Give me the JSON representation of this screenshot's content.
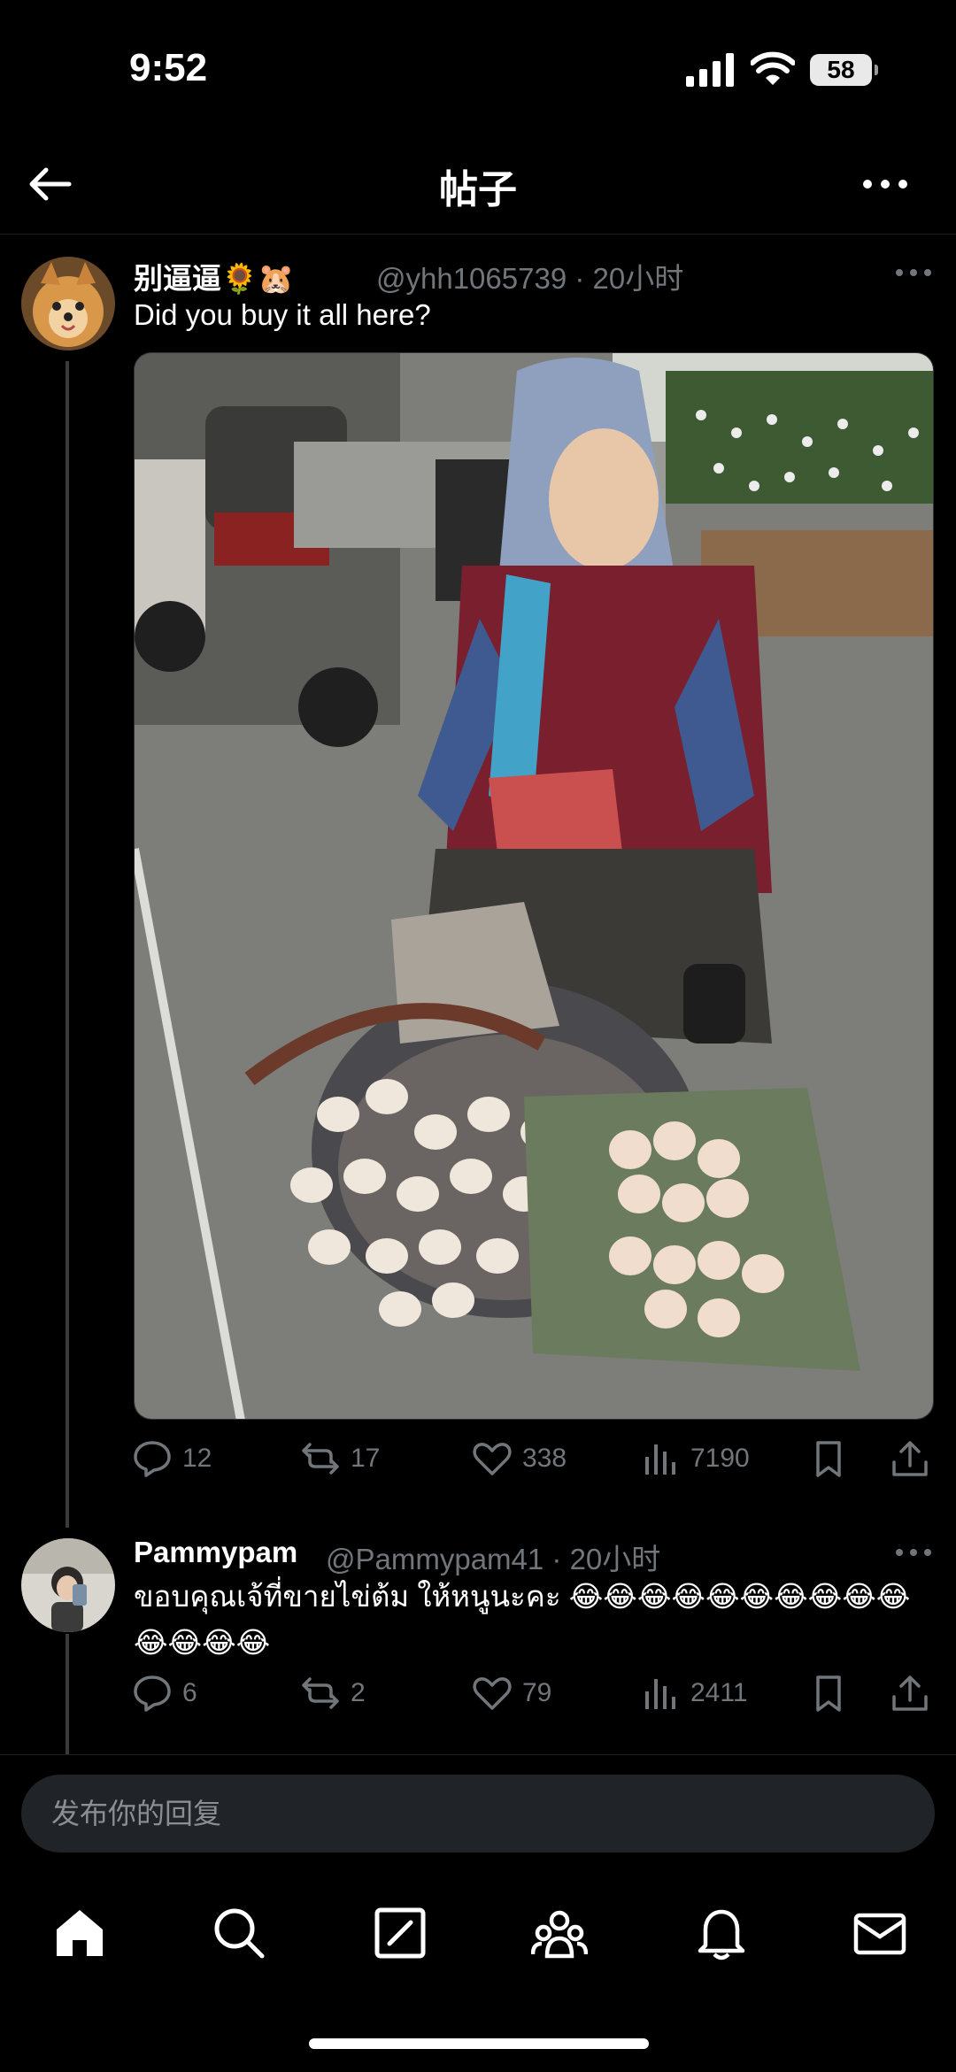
{
  "status_bar": {
    "time": "9:52",
    "battery": "58"
  },
  "header": {
    "title": "帖子"
  },
  "tweets": [
    {
      "name": "别逼逼🌻🐹",
      "handle_time": "@yhh1065739 · 20小时",
      "text": "Did you buy it all here?",
      "image_alt": "woman with basket of eggs",
      "stats": {
        "replies": "12",
        "reposts": "17",
        "likes": "338",
        "views": "7190"
      }
    },
    {
      "name": "Pammypam",
      "handle_time": "@Pammypam41 · 20小时",
      "text": "ขอบคุณเจ้ที่ขายไข่ต้ม ให้หนูนะคะ 😂😂😂😂😂😂😂😂😂😂😂😂😂😂",
      "stats": {
        "replies": "6",
        "reposts": "2",
        "likes": "79",
        "views": "2411"
      }
    }
  ],
  "reply": {
    "placeholder": "发布你的回复"
  },
  "tabs": [
    "home",
    "search",
    "compose",
    "communities",
    "notifications",
    "messages"
  ],
  "colors": {
    "background": "#000000",
    "muted": "#71767b",
    "text": "#e7e9ea",
    "input_bg": "#202327"
  }
}
